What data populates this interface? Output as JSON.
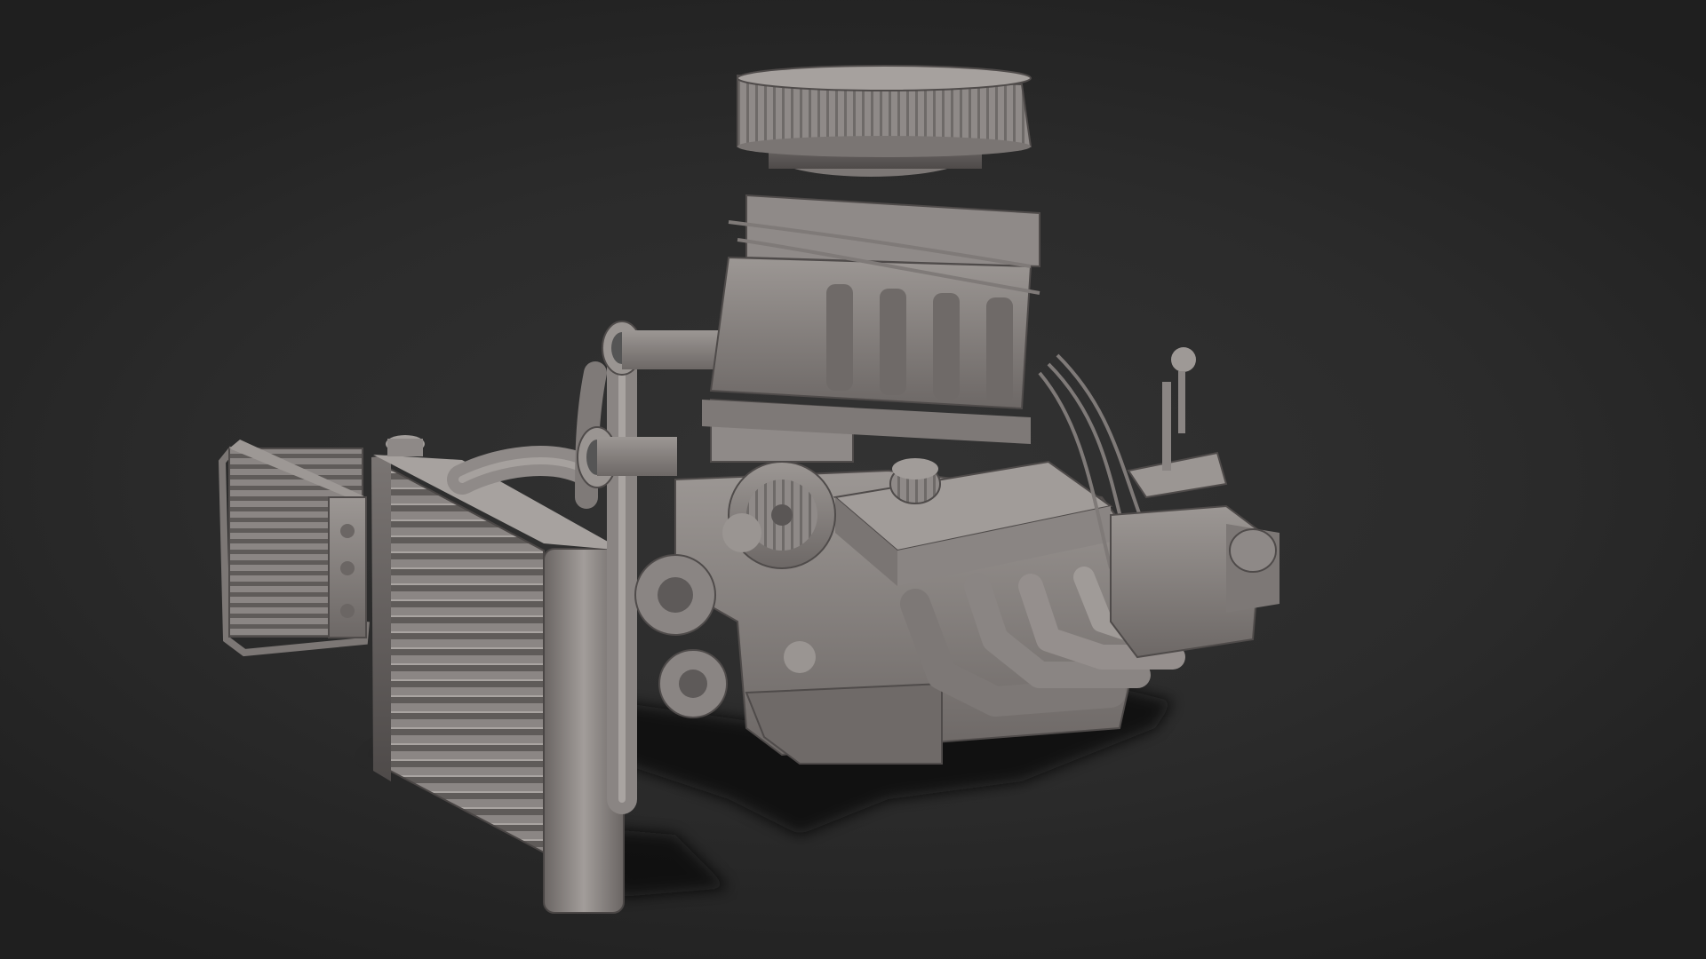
{
  "viewport": {
    "background_color": "#2b2b2b",
    "model_color": "#8c8785",
    "shadow_color": "#0b0b0b"
  },
  "scene": {
    "subject": "engine-3d-model",
    "components": [
      "air-cleaner",
      "carburetors",
      "supercharger",
      "velocity-stacks",
      "radiator",
      "oil-cooler",
      "alternator",
      "engine-block",
      "valve-cover",
      "breather",
      "exhaust-headers",
      "transmission",
      "gear-shifter",
      "pulleys",
      "spark-plug-wires"
    ]
  }
}
